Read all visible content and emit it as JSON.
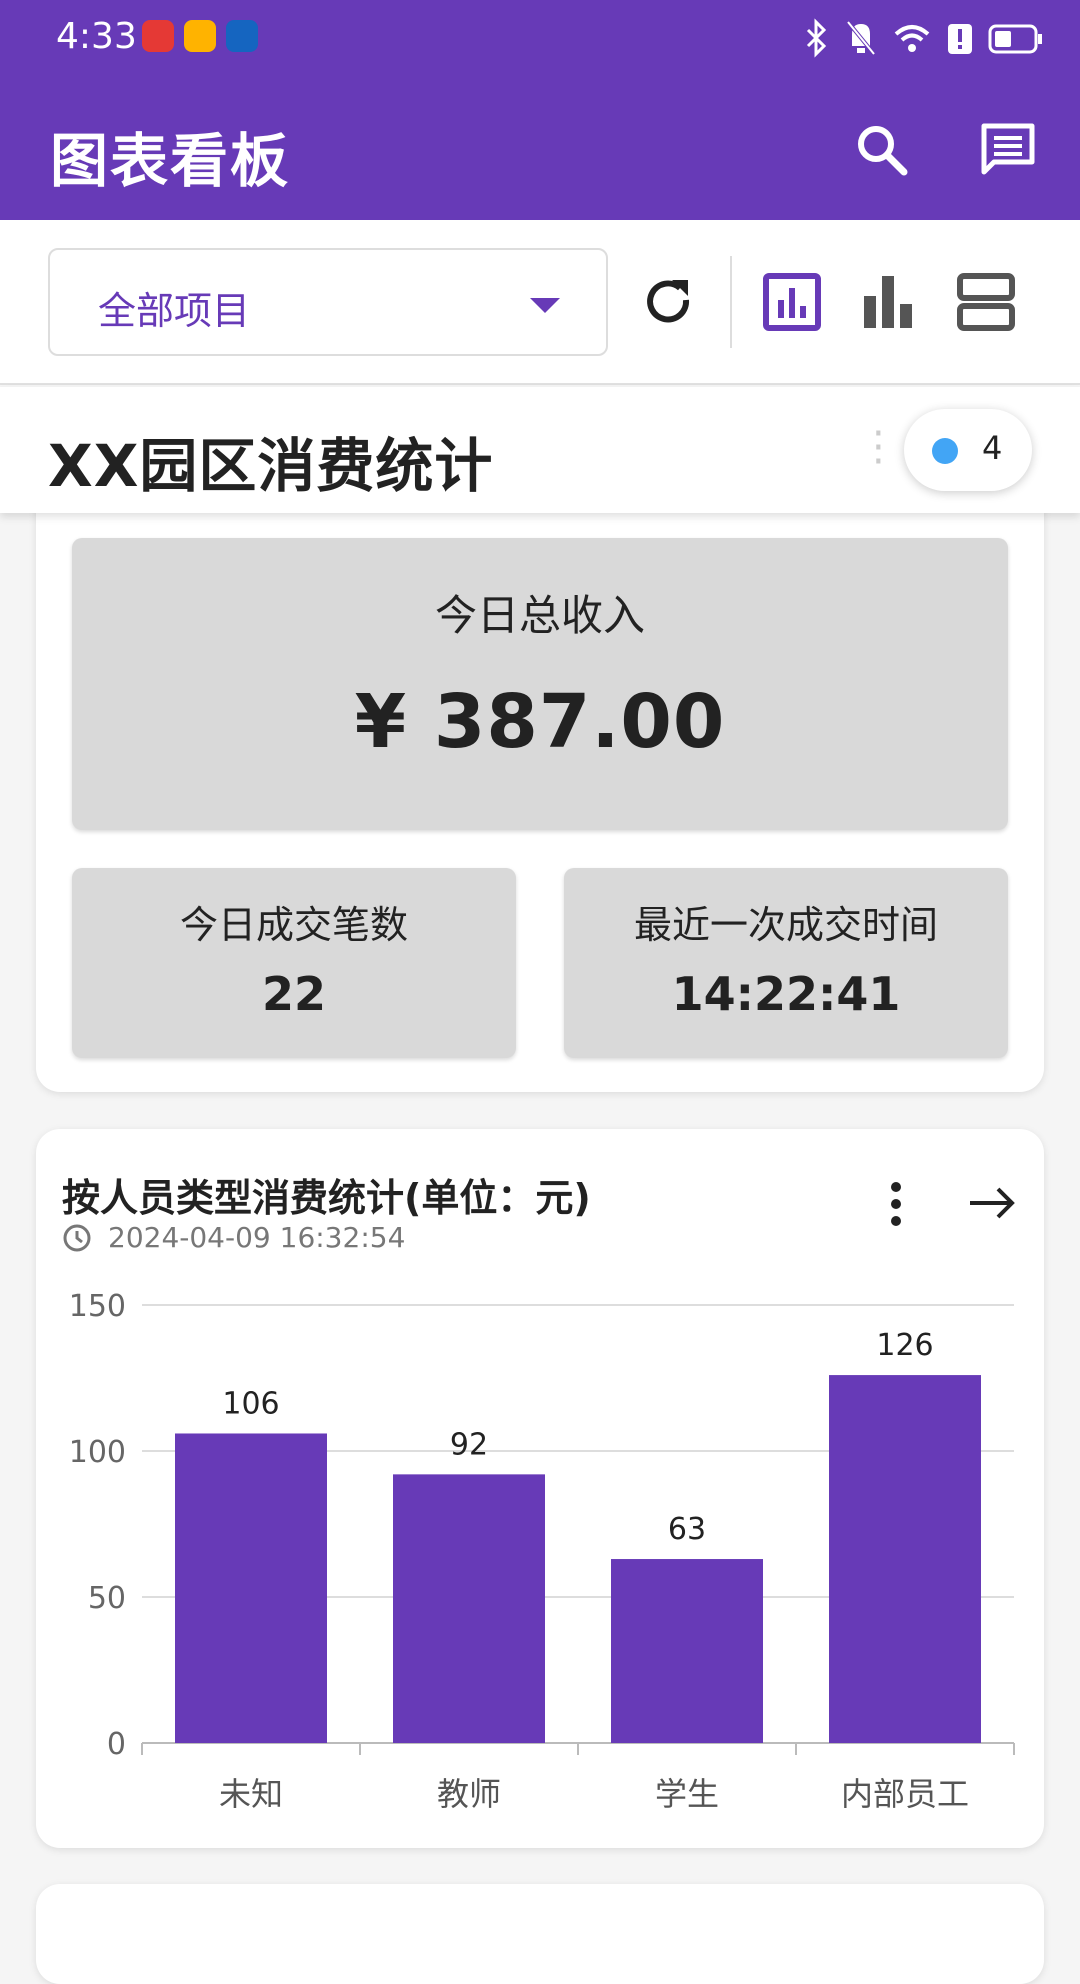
{
  "status": {
    "time": "4:33",
    "app_icons": [
      "huawei-store-icon",
      "yellow-app-icon",
      "bulb-app-icon"
    ],
    "right_icons": [
      "bluetooth-icon",
      "bell-muted-icon",
      "wifi-icon",
      "alert-icon",
      "battery-icon"
    ]
  },
  "appbar": {
    "title": "图表看板",
    "icons": [
      "search-icon",
      "message-icon"
    ],
    "color": "#673ab7"
  },
  "toolbar": {
    "project_select": "全部项目",
    "icons": [
      "refresh-icon",
      "chart-view-icon",
      "bar-chart-icon",
      "list-view-icon"
    ]
  },
  "sticky": {
    "title": "XX园区消费统计",
    "badge_count": "4"
  },
  "summary": {
    "total_label": "今日总收入",
    "total_value": "¥ 387.00",
    "count_label": "今日成交笔数",
    "count_value": "22",
    "last_label": "最近一次成交时间",
    "last_value": "14:22:41"
  },
  "chart_card": {
    "title": "按人员类型消费统计(单位：元)",
    "timestamp": "2024-04-09 16:32:54"
  },
  "chart_data": {
    "type": "bar",
    "categories": [
      "未知",
      "教师",
      "学生",
      "内部员工"
    ],
    "values": [
      106,
      92,
      63,
      126
    ],
    "ylim": [
      0,
      150
    ],
    "yticks": [
      0,
      50,
      100,
      150
    ],
    "bar_color": "#673ab7",
    "grid": true
  }
}
